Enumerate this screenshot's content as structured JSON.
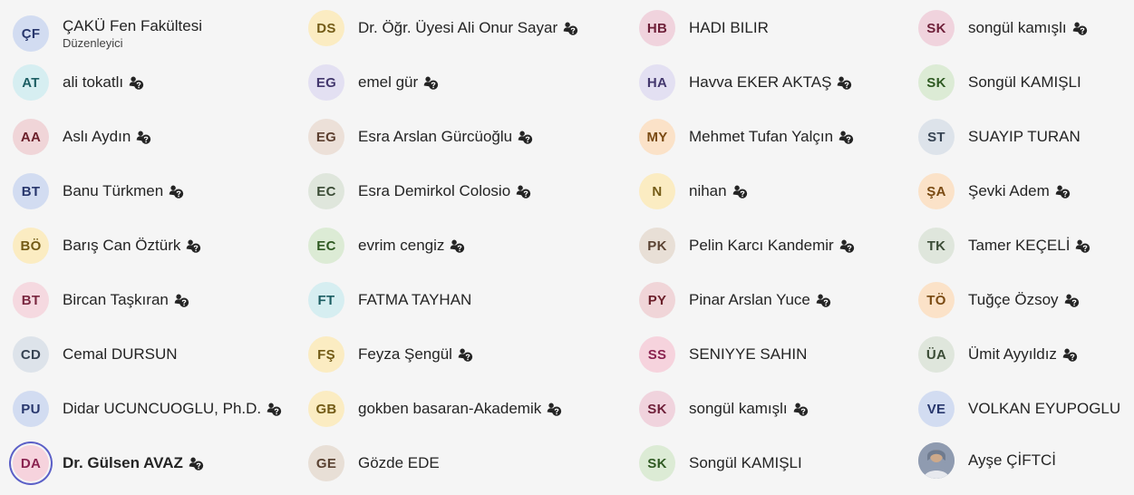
{
  "col1": [
    {
      "initials": "ÇF",
      "name": "ÇAKÜ Fen Fakültesi",
      "role": "Düzenleyici",
      "color": "c-blue",
      "external": false
    },
    {
      "initials": "AT",
      "name": "ali tokatlı",
      "color": "c-teal",
      "external": true
    },
    {
      "initials": "AA",
      "name": "Aslı Aydın",
      "color": "c-rose",
      "external": true
    },
    {
      "initials": "BT",
      "name": "Banu Türkmen",
      "color": "c-blue",
      "external": true
    },
    {
      "initials": "BÖ",
      "name": "Barış Can Öztürk",
      "color": "c-yellow",
      "external": true
    },
    {
      "initials": "BT",
      "name": "Bircan Taşkıran",
      "color": "c-pink",
      "external": true
    },
    {
      "initials": "CD",
      "name": "Cemal DURSUN",
      "color": "c-gray",
      "external": false
    },
    {
      "initials": "PU",
      "name": "Didar UCUNCUOGLU, Ph.D.",
      "color": "c-blue",
      "external": true
    },
    {
      "initials": "DA",
      "name": "Dr. Gülsen AVAZ",
      "color": "c-dpink",
      "external": true,
      "bold": true,
      "selected": true
    }
  ],
  "col2": [
    {
      "initials": "DS",
      "name": "Dr. Öğr. Üyesi Ali Onur Sayar",
      "color": "c-yellow",
      "external": true
    },
    {
      "initials": "EG",
      "name": "emel gür",
      "color": "c-lav",
      "external": true
    },
    {
      "initials": "EG",
      "name": "Esra Arslan Gürcüoğlu",
      "color": "c-sand",
      "external": true
    },
    {
      "initials": "EC",
      "name": "Esra Demirkol Colosio",
      "color": "c-sage",
      "external": true
    },
    {
      "initials": "EC",
      "name": "evrim cengiz",
      "color": "c-green",
      "external": true
    },
    {
      "initials": "FT",
      "name": "FATMA TAYHAN",
      "color": "c-teal",
      "external": false
    },
    {
      "initials": "FŞ",
      "name": "Feyza Şengül",
      "color": "c-yellow",
      "external": true
    },
    {
      "initials": "GB",
      "name": "gokben basaran-Akademik",
      "color": "c-yellow",
      "external": true
    },
    {
      "initials": "GE",
      "name": "Gözde EDE",
      "color": "c-beige",
      "external": false
    }
  ],
  "col3": [
    {
      "initials": "HB",
      "name": "HADI BILIR",
      "color": "c-mauve",
      "external": false
    },
    {
      "initials": "HA",
      "name": "Havva EKER AKTAŞ",
      "color": "c-lav",
      "external": true
    },
    {
      "initials": "MY",
      "name": "Mehmet Tufan Yalçın",
      "color": "c-peach",
      "external": true
    },
    {
      "initials": "N",
      "name": "nihan",
      "color": "c-yellow",
      "external": true
    },
    {
      "initials": "PK",
      "name": "Pelin Karcı Kandemir",
      "color": "c-beige",
      "external": true
    },
    {
      "initials": "PY",
      "name": "Pinar Arslan Yuce",
      "color": "c-rose",
      "external": true
    },
    {
      "initials": "SS",
      "name": "SENIYYE SAHIN",
      "color": "c-dpink",
      "external": false
    },
    {
      "initials": "SK",
      "name": "songül kamışlı",
      "color": "c-mauve",
      "external": true
    },
    {
      "initials": "SK",
      "name": "Songül KAMIŞLI",
      "color": "c-green",
      "external": false
    }
  ],
  "col4": [
    {
      "initials": "SK",
      "name": "songül kamışlı",
      "color": "c-mauve",
      "external": true
    },
    {
      "initials": "SK",
      "name": "Songül KAMIŞLI",
      "color": "c-green",
      "external": false
    },
    {
      "initials": "ST",
      "name": "SUAYIP TURAN",
      "color": "c-gray",
      "external": false
    },
    {
      "initials": "ŞA",
      "name": "Şevki Adem",
      "color": "c-peach",
      "external": true
    },
    {
      "initials": "TK",
      "name": "Tamer KEÇELİ",
      "color": "c-sage",
      "external": true
    },
    {
      "initials": "TÖ",
      "name": "Tuğçe Özsoy",
      "color": "c-peach",
      "external": true
    },
    {
      "initials": "ÜA",
      "name": "Ümit Ayyıldız",
      "color": "c-sage",
      "external": true
    },
    {
      "initials": "VE",
      "name": "VOLKAN EYUPOGLU",
      "color": "c-blue",
      "external": false
    },
    {
      "initials": "",
      "name": "Ayşe ÇİFTCİ",
      "color": "photo",
      "external": false,
      "photo": true
    }
  ]
}
